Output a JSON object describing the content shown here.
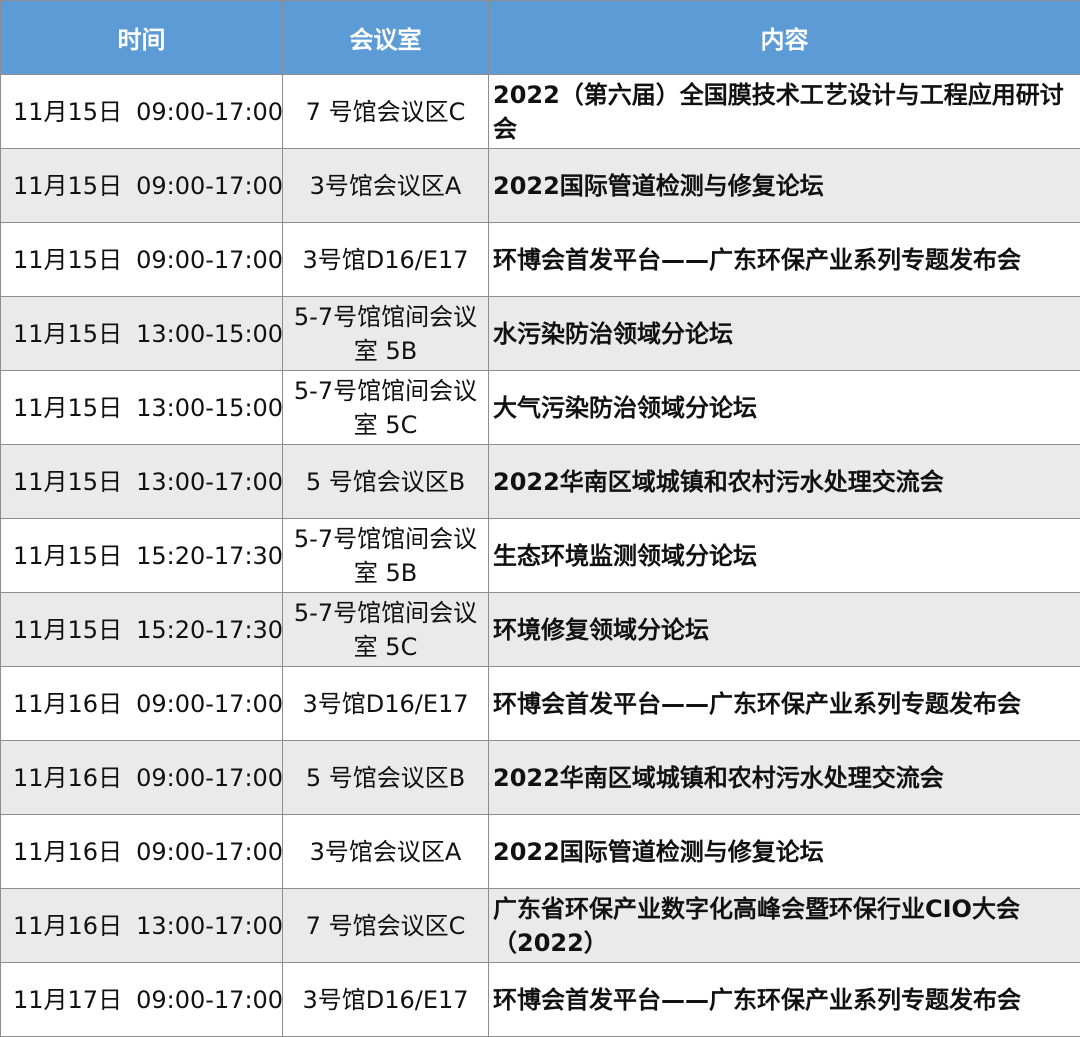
{
  "table": {
    "headers": {
      "time": "时间",
      "room": "会议室",
      "content": "内容"
    },
    "rows": [
      {
        "date": "11月15日",
        "time": "09:00-17:00",
        "room": "7 号馆会议区C",
        "content": "2022（第六届）全国膜技术工艺设计与工程应用研讨会"
      },
      {
        "date": "11月15日",
        "time": "09:00-17:00",
        "room": "3号馆会议区A",
        "content": "2022国际管道检测与修复论坛"
      },
      {
        "date": "11月15日",
        "time": "09:00-17:00",
        "room": "3号馆D16/E17",
        "content": "环博会首发平台——广东环保产业系列专题发布会"
      },
      {
        "date": "11月15日",
        "time": "13:00-15:00",
        "room": "5-7号馆馆间会议室 5B",
        "content": "水污染防治领域分论坛"
      },
      {
        "date": "11月15日",
        "time": "13:00-15:00",
        "room": "5-7号馆馆间会议室 5C",
        "content": "大气污染防治领域分论坛"
      },
      {
        "date": "11月15日",
        "time": "13:00-17:00",
        "room": "5 号馆会议区B",
        "content": "2022华南区域城镇和农村污水处理交流会"
      },
      {
        "date": "11月15日",
        "time": "15:20-17:30",
        "room": "5-7号馆馆间会议室 5B",
        "content": "生态环境监测领域分论坛"
      },
      {
        "date": "11月15日",
        "time": "15:20-17:30",
        "room": "5-7号馆馆间会议室 5C",
        "content": "环境修复领域分论坛"
      },
      {
        "date": "11月16日",
        "time": "09:00-17:00",
        "room": "3号馆D16/E17",
        "content": "环博会首发平台——广东环保产业系列专题发布会"
      },
      {
        "date": "11月16日",
        "time": "09:00-17:00",
        "room": "5 号馆会议区B",
        "content": "2022华南区域城镇和农村污水处理交流会"
      },
      {
        "date": "11月16日",
        "time": "09:00-17:00",
        "room": "3号馆会议区A",
        "content": "2022国际管道检测与修复论坛"
      },
      {
        "date": "11月16日",
        "time": "13:00-17:00",
        "room": "7 号馆会议区C",
        "content": "广东省环保产业数字化高峰会暨环保行业CIO大会（2022）"
      },
      {
        "date": "11月17日",
        "time": "09:00-17:00",
        "room": "3号馆D16/E17",
        "content": "环博会首发平台——广东环保产业系列专题发布会"
      }
    ]
  },
  "colors": {
    "header_background": "#5c9bd5",
    "header_text": "#ffffff",
    "row_even_background": "#eaeaea",
    "row_odd_background": "#ffffff",
    "border": "#8d8d8d"
  }
}
